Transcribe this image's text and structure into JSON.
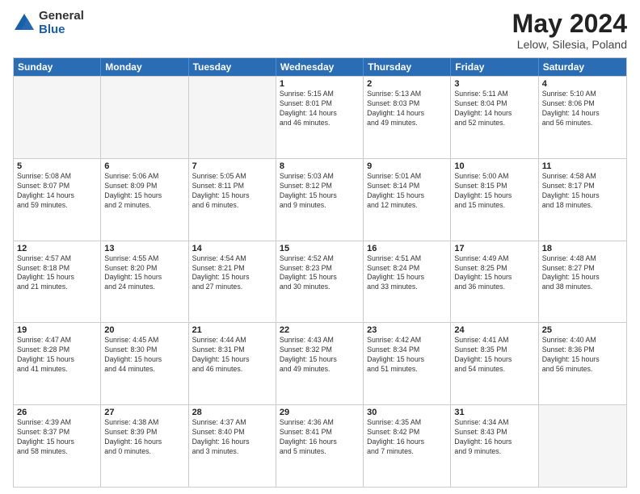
{
  "header": {
    "logo_general": "General",
    "logo_blue": "Blue",
    "month_year": "May 2024",
    "location": "Lelow, Silesia, Poland"
  },
  "weekdays": [
    "Sunday",
    "Monday",
    "Tuesday",
    "Wednesday",
    "Thursday",
    "Friday",
    "Saturday"
  ],
  "rows": [
    [
      {
        "day": "",
        "info": ""
      },
      {
        "day": "",
        "info": ""
      },
      {
        "day": "",
        "info": ""
      },
      {
        "day": "1",
        "info": "Sunrise: 5:15 AM\nSunset: 8:01 PM\nDaylight: 14 hours\nand 46 minutes."
      },
      {
        "day": "2",
        "info": "Sunrise: 5:13 AM\nSunset: 8:03 PM\nDaylight: 14 hours\nand 49 minutes."
      },
      {
        "day": "3",
        "info": "Sunrise: 5:11 AM\nSunset: 8:04 PM\nDaylight: 14 hours\nand 52 minutes."
      },
      {
        "day": "4",
        "info": "Sunrise: 5:10 AM\nSunset: 8:06 PM\nDaylight: 14 hours\nand 56 minutes."
      }
    ],
    [
      {
        "day": "5",
        "info": "Sunrise: 5:08 AM\nSunset: 8:07 PM\nDaylight: 14 hours\nand 59 minutes."
      },
      {
        "day": "6",
        "info": "Sunrise: 5:06 AM\nSunset: 8:09 PM\nDaylight: 15 hours\nand 2 minutes."
      },
      {
        "day": "7",
        "info": "Sunrise: 5:05 AM\nSunset: 8:11 PM\nDaylight: 15 hours\nand 6 minutes."
      },
      {
        "day": "8",
        "info": "Sunrise: 5:03 AM\nSunset: 8:12 PM\nDaylight: 15 hours\nand 9 minutes."
      },
      {
        "day": "9",
        "info": "Sunrise: 5:01 AM\nSunset: 8:14 PM\nDaylight: 15 hours\nand 12 minutes."
      },
      {
        "day": "10",
        "info": "Sunrise: 5:00 AM\nSunset: 8:15 PM\nDaylight: 15 hours\nand 15 minutes."
      },
      {
        "day": "11",
        "info": "Sunrise: 4:58 AM\nSunset: 8:17 PM\nDaylight: 15 hours\nand 18 minutes."
      }
    ],
    [
      {
        "day": "12",
        "info": "Sunrise: 4:57 AM\nSunset: 8:18 PM\nDaylight: 15 hours\nand 21 minutes."
      },
      {
        "day": "13",
        "info": "Sunrise: 4:55 AM\nSunset: 8:20 PM\nDaylight: 15 hours\nand 24 minutes."
      },
      {
        "day": "14",
        "info": "Sunrise: 4:54 AM\nSunset: 8:21 PM\nDaylight: 15 hours\nand 27 minutes."
      },
      {
        "day": "15",
        "info": "Sunrise: 4:52 AM\nSunset: 8:23 PM\nDaylight: 15 hours\nand 30 minutes."
      },
      {
        "day": "16",
        "info": "Sunrise: 4:51 AM\nSunset: 8:24 PM\nDaylight: 15 hours\nand 33 minutes."
      },
      {
        "day": "17",
        "info": "Sunrise: 4:49 AM\nSunset: 8:25 PM\nDaylight: 15 hours\nand 36 minutes."
      },
      {
        "day": "18",
        "info": "Sunrise: 4:48 AM\nSunset: 8:27 PM\nDaylight: 15 hours\nand 38 minutes."
      }
    ],
    [
      {
        "day": "19",
        "info": "Sunrise: 4:47 AM\nSunset: 8:28 PM\nDaylight: 15 hours\nand 41 minutes."
      },
      {
        "day": "20",
        "info": "Sunrise: 4:45 AM\nSunset: 8:30 PM\nDaylight: 15 hours\nand 44 minutes."
      },
      {
        "day": "21",
        "info": "Sunrise: 4:44 AM\nSunset: 8:31 PM\nDaylight: 15 hours\nand 46 minutes."
      },
      {
        "day": "22",
        "info": "Sunrise: 4:43 AM\nSunset: 8:32 PM\nDaylight: 15 hours\nand 49 minutes."
      },
      {
        "day": "23",
        "info": "Sunrise: 4:42 AM\nSunset: 8:34 PM\nDaylight: 15 hours\nand 51 minutes."
      },
      {
        "day": "24",
        "info": "Sunrise: 4:41 AM\nSunset: 8:35 PM\nDaylight: 15 hours\nand 54 minutes."
      },
      {
        "day": "25",
        "info": "Sunrise: 4:40 AM\nSunset: 8:36 PM\nDaylight: 15 hours\nand 56 minutes."
      }
    ],
    [
      {
        "day": "26",
        "info": "Sunrise: 4:39 AM\nSunset: 8:37 PM\nDaylight: 15 hours\nand 58 minutes."
      },
      {
        "day": "27",
        "info": "Sunrise: 4:38 AM\nSunset: 8:39 PM\nDaylight: 16 hours\nand 0 minutes."
      },
      {
        "day": "28",
        "info": "Sunrise: 4:37 AM\nSunset: 8:40 PM\nDaylight: 16 hours\nand 3 minutes."
      },
      {
        "day": "29",
        "info": "Sunrise: 4:36 AM\nSunset: 8:41 PM\nDaylight: 16 hours\nand 5 minutes."
      },
      {
        "day": "30",
        "info": "Sunrise: 4:35 AM\nSunset: 8:42 PM\nDaylight: 16 hours\nand 7 minutes."
      },
      {
        "day": "31",
        "info": "Sunrise: 4:34 AM\nSunset: 8:43 PM\nDaylight: 16 hours\nand 9 minutes."
      },
      {
        "day": "",
        "info": ""
      }
    ]
  ]
}
